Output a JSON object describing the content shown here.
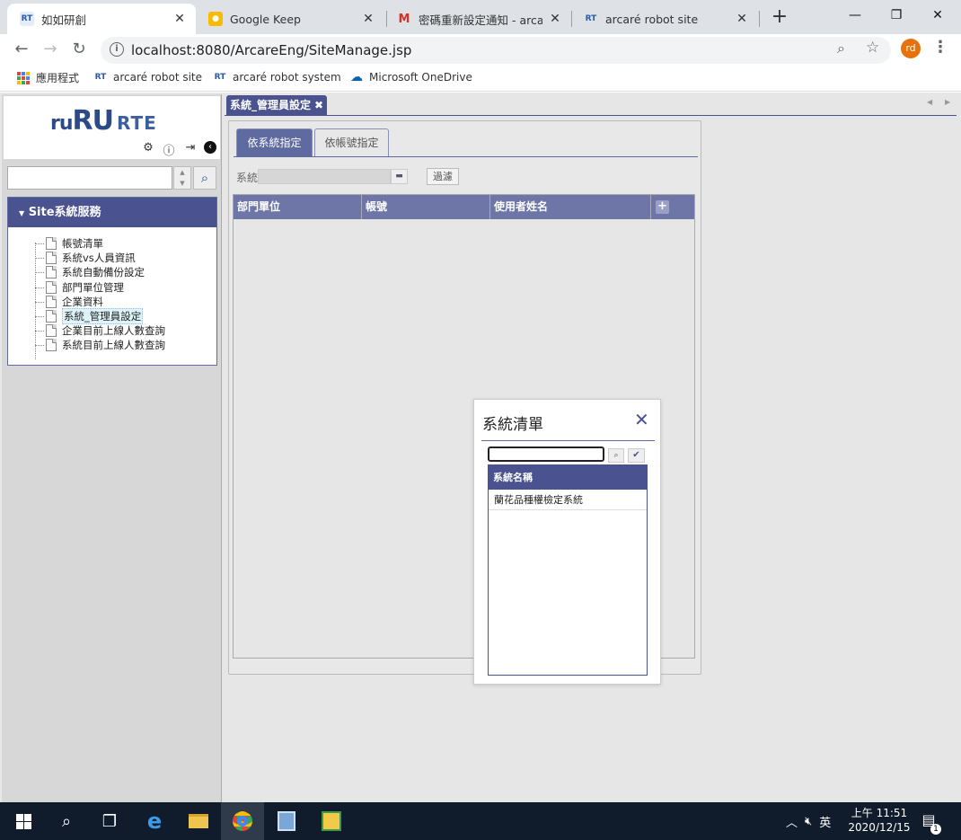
{
  "browser": {
    "tabs": [
      {
        "title": "如如研創",
        "favicon": "RT",
        "active": true
      },
      {
        "title": "Google Keep",
        "favicon": "keep-icon",
        "active": false
      },
      {
        "title": "密碼重新設定通知 - arcare",
        "favicon": "gmail-icon",
        "active": false
      },
      {
        "title": "arcaré robot site",
        "favicon": "RT",
        "active": false
      }
    ],
    "url": "localhost:8080/ArcareEng/SiteManage.jsp",
    "profile_initials": "rd",
    "bookmarks": [
      {
        "label": "應用程式",
        "icon": "apps-icon"
      },
      {
        "label": "arcaré robot site",
        "icon": "RT"
      },
      {
        "label": "arcaré robot system",
        "icon": "RT"
      },
      {
        "label": "Microsoft OneDrive",
        "icon": "onedrive-icon"
      }
    ]
  },
  "sidebar": {
    "logo": {
      "part1": "ru",
      "part2": "RU",
      "part3": "RTE"
    },
    "search_value": "",
    "panel_title": "Site系統服務",
    "items": [
      {
        "label": "帳號清單"
      },
      {
        "label": "系統vs人員資訊"
      },
      {
        "label": "系統自動備份設定"
      },
      {
        "label": "部門單位管理"
      },
      {
        "label": "企業資料"
      },
      {
        "label": "系統_管理員設定",
        "selected": true
      },
      {
        "label": "企業目前上線人數查詢"
      },
      {
        "label": "系統目前上線人數查詢"
      }
    ]
  },
  "main": {
    "tab_title": "系統_管理員設定",
    "subtabs": [
      {
        "label": "依系統指定",
        "active": true
      },
      {
        "label": "依帳號指定",
        "active": false
      }
    ],
    "system_label": "系統",
    "system_value": "",
    "filter_label": "過濾",
    "grid_columns": [
      "部門單位",
      "帳號",
      "使用者姓名"
    ]
  },
  "dialog": {
    "title": "系統清單",
    "search_value": "",
    "list_header": "系統名稱",
    "rows": [
      "蘭花品種權檢定系統"
    ]
  },
  "taskbar": {
    "ime": "英",
    "time": "上午 11:51",
    "date": "2020/12/15",
    "notification_count": "1"
  },
  "colors": {
    "accent": "#4a5290",
    "accent_light": "#6e76a8",
    "tab_strip": "#dee1e6",
    "taskbar": "#101c2b"
  }
}
